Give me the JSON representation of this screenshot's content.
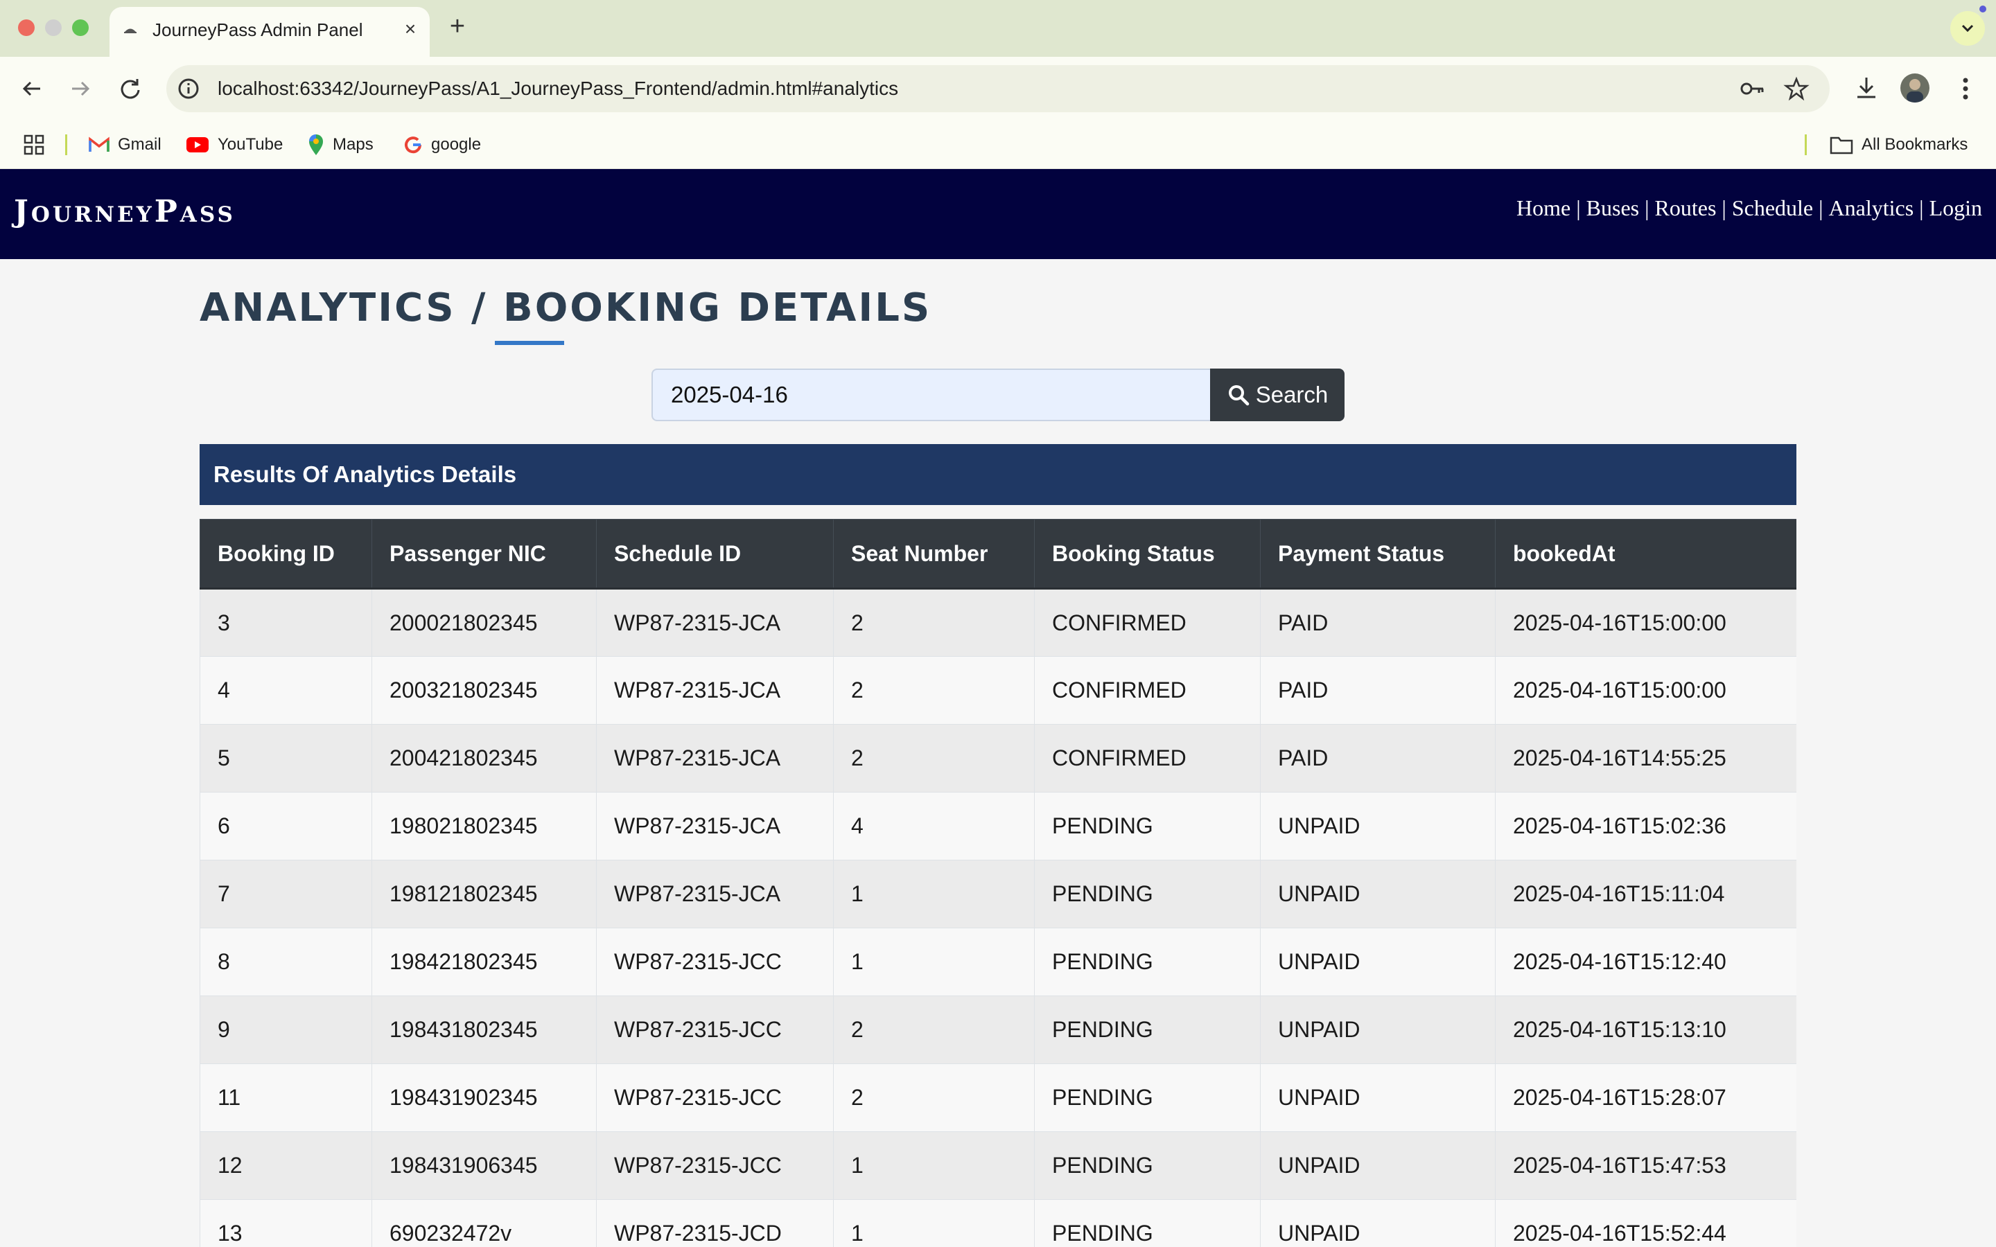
{
  "browser": {
    "tab_title": "JourneyPass Admin Panel",
    "url": "localhost:63342/JourneyPass/A1_JourneyPass_Frontend/admin.html#analytics",
    "bookmarks": [
      "Gmail",
      "YouTube",
      "Maps",
      "google"
    ],
    "all_bookmarks": "All Bookmarks"
  },
  "header": {
    "brand": "JourneyPass",
    "nav": [
      "Home",
      "Buses",
      "Routes",
      "Schedule",
      "Analytics",
      "Login"
    ],
    "separator": "|"
  },
  "page": {
    "title": "ANALYTICS / BOOKING DETAILS"
  },
  "search": {
    "value": "2025-04-16",
    "button_label": "Search"
  },
  "results": {
    "heading": "Results Of Analytics Details",
    "columns": [
      "Booking ID",
      "Passenger NIC",
      "Schedule ID",
      "Seat Number",
      "Booking Status",
      "Payment Status",
      "bookedAt"
    ],
    "rows": [
      [
        "3",
        "200021802345",
        "WP87-2315-JCA",
        "2",
        "CONFIRMED",
        "PAID",
        "2025-04-16T15:00:00"
      ],
      [
        "4",
        "200321802345",
        "WP87-2315-JCA",
        "2",
        "CONFIRMED",
        "PAID",
        "2025-04-16T15:00:00"
      ],
      [
        "5",
        "200421802345",
        "WP87-2315-JCA",
        "2",
        "CONFIRMED",
        "PAID",
        "2025-04-16T14:55:25"
      ],
      [
        "6",
        "198021802345",
        "WP87-2315-JCA",
        "4",
        "PENDING",
        "UNPAID",
        "2025-04-16T15:02:36"
      ],
      [
        "7",
        "198121802345",
        "WP87-2315-JCA",
        "1",
        "PENDING",
        "UNPAID",
        "2025-04-16T15:11:04"
      ],
      [
        "8",
        "198421802345",
        "WP87-2315-JCC",
        "1",
        "PENDING",
        "UNPAID",
        "2025-04-16T15:12:40"
      ],
      [
        "9",
        "198431802345",
        "WP87-2315-JCC",
        "2",
        "PENDING",
        "UNPAID",
        "2025-04-16T15:13:10"
      ],
      [
        "11",
        "198431902345",
        "WP87-2315-JCC",
        "2",
        "PENDING",
        "UNPAID",
        "2025-04-16T15:28:07"
      ],
      [
        "12",
        "198431906345",
        "WP87-2315-JCC",
        "1",
        "PENDING",
        "UNPAID",
        "2025-04-16T15:47:53"
      ],
      [
        "13",
        "690232472v",
        "WP87-2315-JCD",
        "1",
        "PENDING",
        "UNPAID",
        "2025-04-16T15:52:44"
      ]
    ]
  },
  "colors": {
    "header_bg": "#02023e",
    "results_bar_bg": "#1f3864",
    "table_head_bg": "#343a40",
    "accent": "#3478c7"
  }
}
